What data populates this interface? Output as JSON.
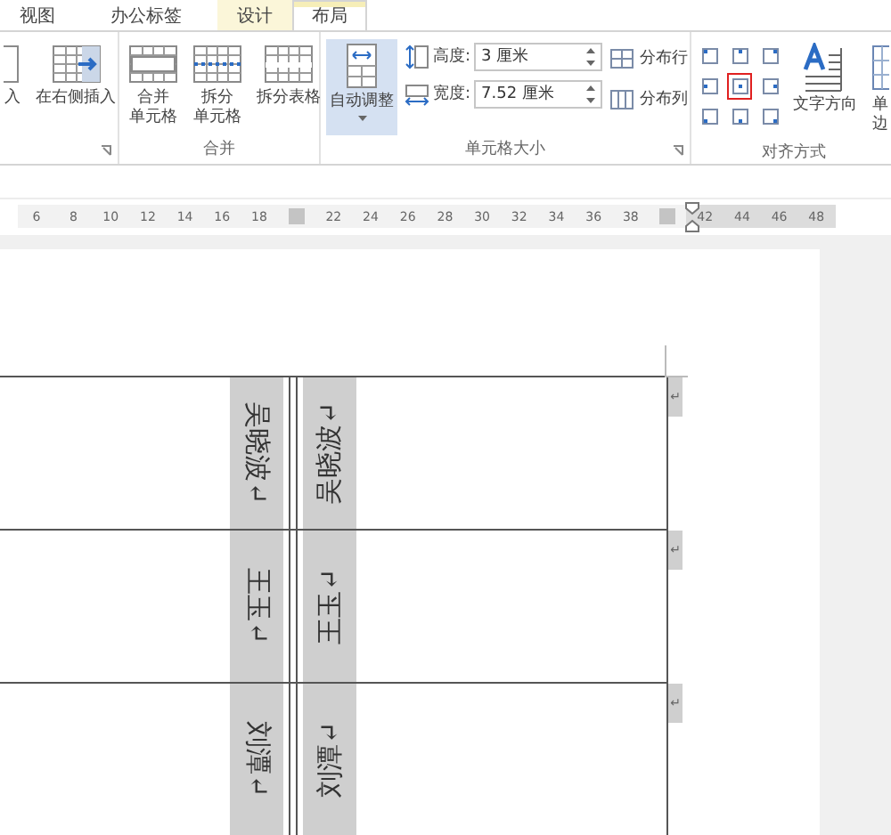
{
  "tabs": [
    {
      "label": "视图",
      "selected": false,
      "contextual": false
    },
    {
      "label": "办公标签",
      "selected": false,
      "contextual": false
    },
    {
      "label": "设计",
      "selected": false,
      "contextual": true
    },
    {
      "label": "布局",
      "selected": true,
      "contextual": true
    }
  ],
  "insert_group": {
    "buttons": [
      {
        "lines": [
          "入"
        ],
        "kind": "partial"
      },
      {
        "lines": [
          "在右侧插入"
        ],
        "kind": "insert-right"
      }
    ]
  },
  "merge_group": {
    "title": "合并",
    "buttons": [
      {
        "lines": [
          "合并",
          "单元格"
        ],
        "kind": "merge"
      },
      {
        "lines": [
          "拆分",
          "单元格"
        ],
        "kind": "split-cells"
      },
      {
        "lines": [
          "拆分表格"
        ],
        "kind": "split-table"
      }
    ]
  },
  "cell_size_group": {
    "title": "单元格大小",
    "autofit": {
      "label": "自动调整",
      "selected": true
    },
    "fields": [
      {
        "label": "高度:",
        "value": "3 厘米",
        "kind": "height"
      },
      {
        "label": "宽度:",
        "value": "7.52 厘米",
        "kind": "width"
      }
    ],
    "distribute": [
      {
        "label": "分布行",
        "kind": "rows"
      },
      {
        "label": "分布列",
        "kind": "columns"
      }
    ]
  },
  "align_group": {
    "title": "对齐方式",
    "cells": [
      {
        "selected": false
      },
      {
        "selected": false
      },
      {
        "selected": false
      },
      {
        "selected": false
      },
      {
        "selected": true
      },
      {
        "selected": false
      },
      {
        "selected": false
      },
      {
        "selected": false
      },
      {
        "selected": false
      }
    ],
    "buttons": [
      {
        "lines": [
          "文字方向"
        ],
        "kind": "direction"
      },
      {
        "lines": [
          "单",
          "边"
        ],
        "kind": "margins"
      }
    ]
  },
  "ruler": {
    "ticks": [
      {
        "kind": "number",
        "label": "6"
      },
      {
        "kind": "number",
        "label": "8"
      },
      {
        "kind": "number",
        "label": "10"
      },
      {
        "kind": "number",
        "label": "12"
      },
      {
        "kind": "number",
        "label": "14"
      },
      {
        "kind": "number",
        "label": "16"
      },
      {
        "kind": "number",
        "label": "18"
      },
      {
        "kind": "marker"
      },
      {
        "kind": "number",
        "label": "22"
      },
      {
        "kind": "number",
        "label": "24"
      },
      {
        "kind": "number",
        "label": "26"
      },
      {
        "kind": "number",
        "label": "28"
      },
      {
        "kind": "number",
        "label": "30"
      },
      {
        "kind": "number",
        "label": "32"
      },
      {
        "kind": "number",
        "label": "34"
      },
      {
        "kind": "number",
        "label": "36"
      },
      {
        "kind": "number",
        "label": "38"
      },
      {
        "kind": "marker"
      },
      {
        "kind": "number",
        "label": "42"
      },
      {
        "kind": "number",
        "label": "44"
      },
      {
        "kind": "number",
        "label": "46"
      },
      {
        "kind": "number",
        "label": "48"
      }
    ]
  },
  "table": {
    "rows": [
      {
        "left": "吴晓波↵",
        "right": "吴晓波↵",
        "end": "↵"
      },
      {
        "left": "王玉↵",
        "right": "王玉↵",
        "end": "↵"
      },
      {
        "left": "刘潭↵",
        "right": "刘潭↵",
        "end": "↵"
      }
    ]
  }
}
